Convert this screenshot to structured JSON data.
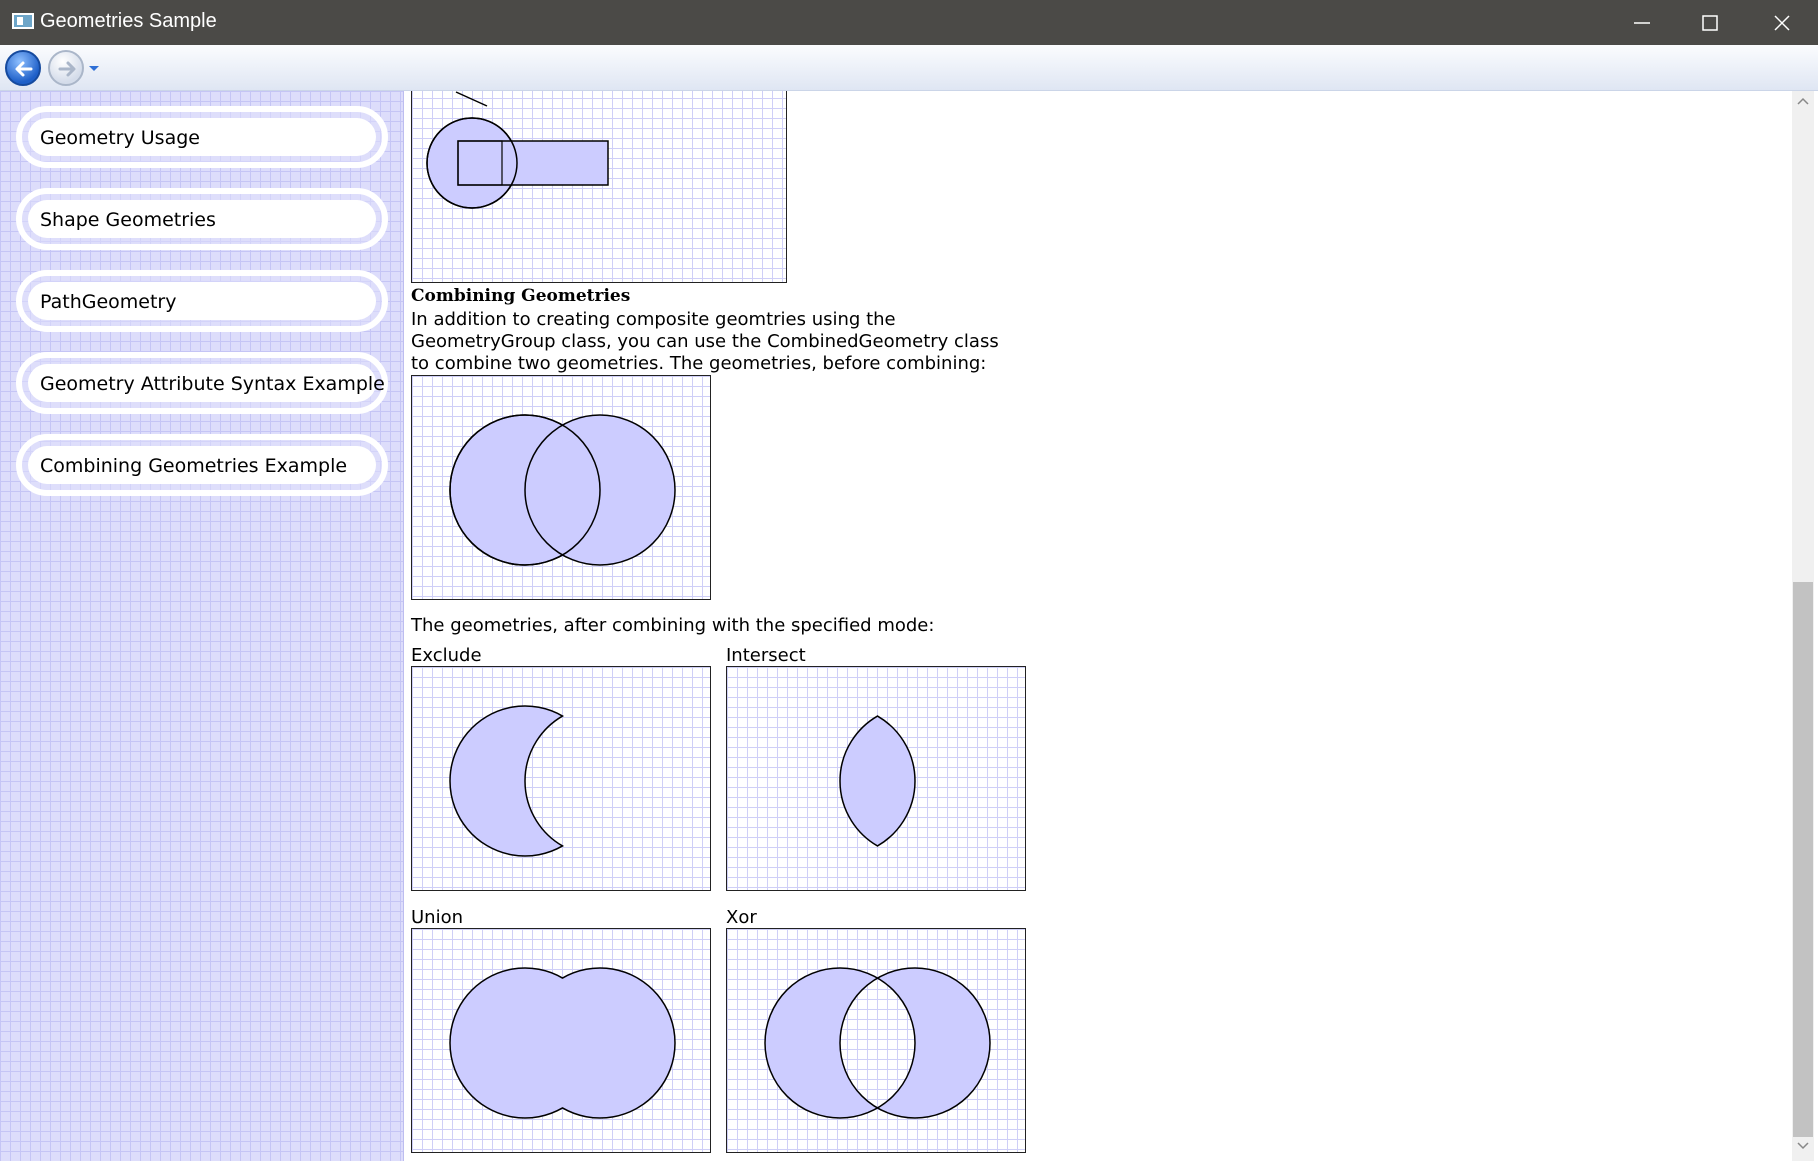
{
  "window": {
    "title": "Geometries Sample"
  },
  "sidebar": {
    "items": [
      {
        "label": "Geometry Usage"
      },
      {
        "label": "Shape Geometries"
      },
      {
        "label": "PathGeometry"
      },
      {
        "label": "Geometry Attribute Syntax Example"
      },
      {
        "label": "Combining Geometries Example"
      }
    ]
  },
  "content": {
    "section_heading": "Combining Geometries",
    "intro_lines": [
      "In addition to creating composite geomtries using the",
      "GeometryGroup class, you can use the CombinedGeometry class",
      "to combine two geometries. The geometries, before combining:"
    ],
    "after_text": "The geometries, after combining with the specified mode:",
    "modes": {
      "exclude": "Exclude",
      "intersect": "Intersect",
      "union": "Union",
      "xor": "Xor"
    }
  },
  "colors": {
    "shape_fill": "#ccccff",
    "grid_line": "#cfcff7",
    "sidebar_bg": "#ddddfb",
    "titlebar": "#4b4a47"
  },
  "icons": {
    "back": "arrow-left-icon",
    "forward": "arrow-right-icon",
    "dropdown": "chevron-down-icon",
    "minimize": "minimize-icon",
    "maximize": "maximize-icon",
    "close": "close-icon"
  }
}
